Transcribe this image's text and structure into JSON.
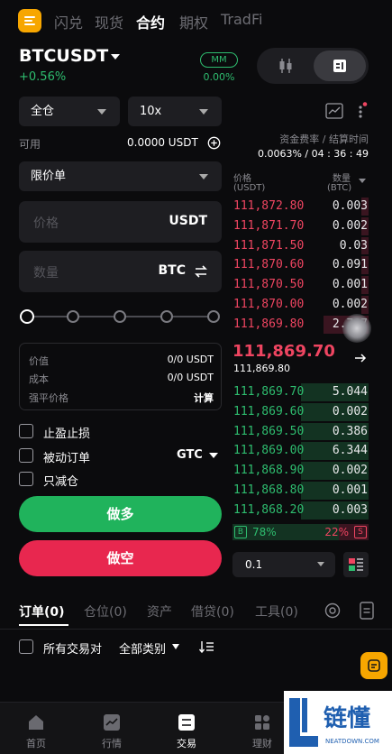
{
  "top_nav": {
    "tabs": [
      {
        "label": "闪兑"
      },
      {
        "label": "现货"
      },
      {
        "label": "合约"
      },
      {
        "label": "期权"
      },
      {
        "label": "TradFi"
      }
    ],
    "active_tab": "合约"
  },
  "header": {
    "symbol": "BTCUSDT",
    "change": "+0.56%",
    "mm_label": "MM",
    "mm_value": "0.00%"
  },
  "form": {
    "margin_mode": "全仓",
    "leverage": "10x",
    "available_label": "可用",
    "available_value": "0.0000 USDT",
    "order_type": "限价单",
    "price_placeholder": "价格",
    "price_unit": "USDT",
    "qty_placeholder": "数量",
    "qty_unit": "BTC",
    "slider_level": 0,
    "cost": {
      "value_label": "价值",
      "value": "0/0 USDT",
      "cost_label": "成本",
      "cost": "0/0 USDT",
      "liq_label": "强平价格",
      "liq_action": "计算"
    },
    "tp_sl": "止盈止损",
    "post_only": "被动订单",
    "tif": "GTC",
    "reduce_only": "只减仓",
    "buy_label": "做多",
    "sell_label": "做空"
  },
  "orderbook": {
    "funding_label": "资金费率 / 结算时间",
    "funding_value": "0.0063% / 04 : 36 : 49",
    "price_header": "价格",
    "price_unit": "(USDT)",
    "qty_header": "数量",
    "qty_unit": "(BTC)",
    "asks": [
      {
        "price": "111,872.80",
        "qty": "0.003"
      },
      {
        "price": "111,871.70",
        "qty": "0.002"
      },
      {
        "price": "111,871.50",
        "qty": "0.03"
      },
      {
        "price": "111,870.60",
        "qty": "0.091"
      },
      {
        "price": "111,870.50",
        "qty": "0.001"
      },
      {
        "price": "111,870.00",
        "qty": "0.002"
      },
      {
        "price": "111,869.80",
        "qty": "2.787"
      }
    ],
    "last_price": "111,869.70",
    "mark_price": "111,869.80",
    "bids": [
      {
        "price": "111,869.70",
        "qty": "5.044"
      },
      {
        "price": "111,869.60",
        "qty": "0.002"
      },
      {
        "price": "111,869.50",
        "qty": "0.386"
      },
      {
        "price": "111,869.00",
        "qty": "6.344"
      },
      {
        "price": "111,868.90",
        "qty": "0.002"
      },
      {
        "price": "111,868.80",
        "qty": "0.001"
      },
      {
        "price": "111,868.20",
        "qty": "0.003"
      }
    ],
    "buy_tag": "B",
    "buy_pct": "78%",
    "sell_pct": "22%",
    "sell_tag": "S",
    "depth_step": "0.1"
  },
  "bottom_tabs": [
    {
      "label": "订单(0)"
    },
    {
      "label": "仓位(0)"
    },
    {
      "label": "资产"
    },
    {
      "label": "借贷(0)"
    },
    {
      "label": "工具(0)"
    }
  ],
  "filters": {
    "all_pairs": "所有交易对",
    "all_categories": "全部类别"
  },
  "bottom_nav": [
    {
      "label": "首页"
    },
    {
      "label": "行情"
    },
    {
      "label": "交易"
    },
    {
      "label": "理财"
    }
  ],
  "watermark": {
    "brand": "链懂",
    "site": "NEATDOWN.COM"
  },
  "colors": {
    "green": "#2ebd6f",
    "red": "#ef4561",
    "accent": "#f7a600"
  }
}
